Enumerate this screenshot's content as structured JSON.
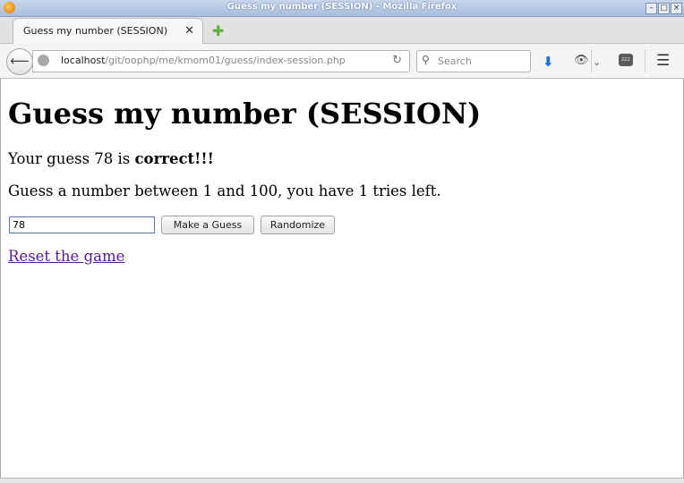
{
  "window": {
    "title": "Guess my number (SESSION) - Mozilla Firefox"
  },
  "tab": {
    "label": "Guess my number (SESSION)",
    "close_glyph": "✕",
    "new_tab_glyph": "✚"
  },
  "navbar": {
    "url_host": "localhost",
    "url_path": "/git/oophp/me/kmom01/guess/index-session.php",
    "search_placeholder": "Search",
    "zzz_label": "zzz"
  },
  "page": {
    "heading": "Guess my number (SESSION)",
    "result_prefix": "Your guess 78 is ",
    "result_word": "correct!!!",
    "instructions": "Guess a number between 1 and 100, you have 1 tries left.",
    "guess_value": "78",
    "guess_button": "Make a Guess",
    "randomize_button": "Randomize",
    "reset_link": "Reset the game"
  },
  "colors": {
    "link_visited": "#551a8b",
    "accent": "#5cb23a"
  },
  "icons": [
    "firefox-icon",
    "back-icon",
    "globe-icon",
    "reload-icon",
    "search-icon",
    "download-icon",
    "ghostery-icon",
    "chevron-down-icon",
    "zzz-icon",
    "menu-icon",
    "close-icon",
    "new-tab-icon"
  ]
}
